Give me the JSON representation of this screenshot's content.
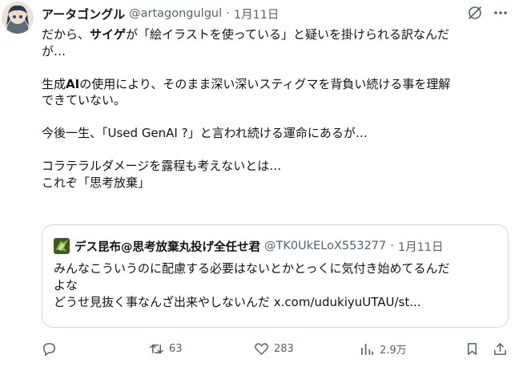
{
  "tweet": {
    "display_name": "アータゴングル",
    "handle": "@artagongulgul",
    "separator": "·",
    "date": "1月11日",
    "body": {
      "l1_a": "だから、",
      "l1_b": "サイゲ",
      "l1_c": "が「絵イラストを使っている」と疑いを掛けられる訳なんだ",
      "l2": "が…",
      "l3_a": "生成",
      "l3_b": "AI",
      "l3_c": "の使用により、そのまま深い深いスティグマを背負い続ける事を理解",
      "l4": "できていない。",
      "l5": "今後一生、「Used GenAI ?」と言われ続ける運命にあるが…",
      "l6": "コラテラルダメージを露程も考えないとは…",
      "l7": "これぞ「思考放棄」"
    }
  },
  "quote": {
    "display_name": "デス昆布@思考放棄丸投げ全任せ君",
    "handle": "@TK0UkELoX553277",
    "separator": "·",
    "date": "1月11日",
    "l1": "みんなこういうのに配慮する必要はないとかとっくに気付き始めてるんだ",
    "l2": "よな",
    "l3": "どうせ見抜く事なんざ出来やしないんだ ",
    "link": "x.com/udukiyuUTAU/st..."
  },
  "actions": {
    "retweets": "63",
    "likes": "283",
    "views": "2.9万"
  },
  "colors": {
    "text": "#0f1419",
    "secondary": "#536471",
    "border": "#cfd9de"
  },
  "icons": [
    "avatar",
    "grok-icon",
    "more-icon",
    "reply-icon",
    "retweet-icon",
    "like-icon",
    "views-icon",
    "bookmark-icon",
    "share-icon"
  ]
}
